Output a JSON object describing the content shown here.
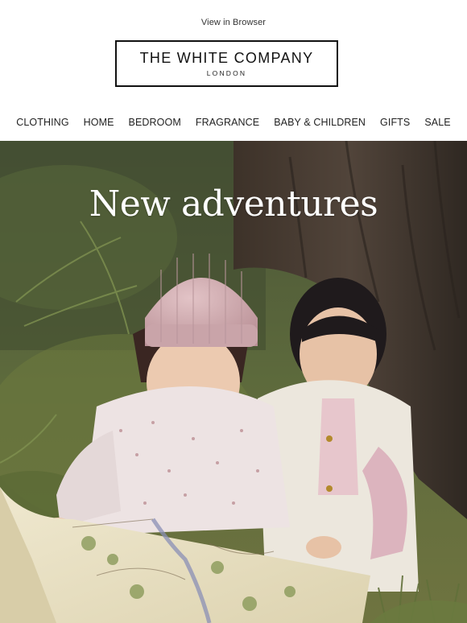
{
  "header": {
    "view_in_browser": "View in Browser",
    "brand_name": "THE WHITE COMPANY",
    "brand_location": "LONDON"
  },
  "nav": {
    "items": [
      "CLOTHING",
      "HOME",
      "BEDROOM",
      "FRAGRANCE",
      "BABY & CHILDREN",
      "GIFTS",
      "SALE"
    ]
  },
  "hero": {
    "headline": "New adventures",
    "image_alt": "Two children sitting under a tree reading a map"
  }
}
